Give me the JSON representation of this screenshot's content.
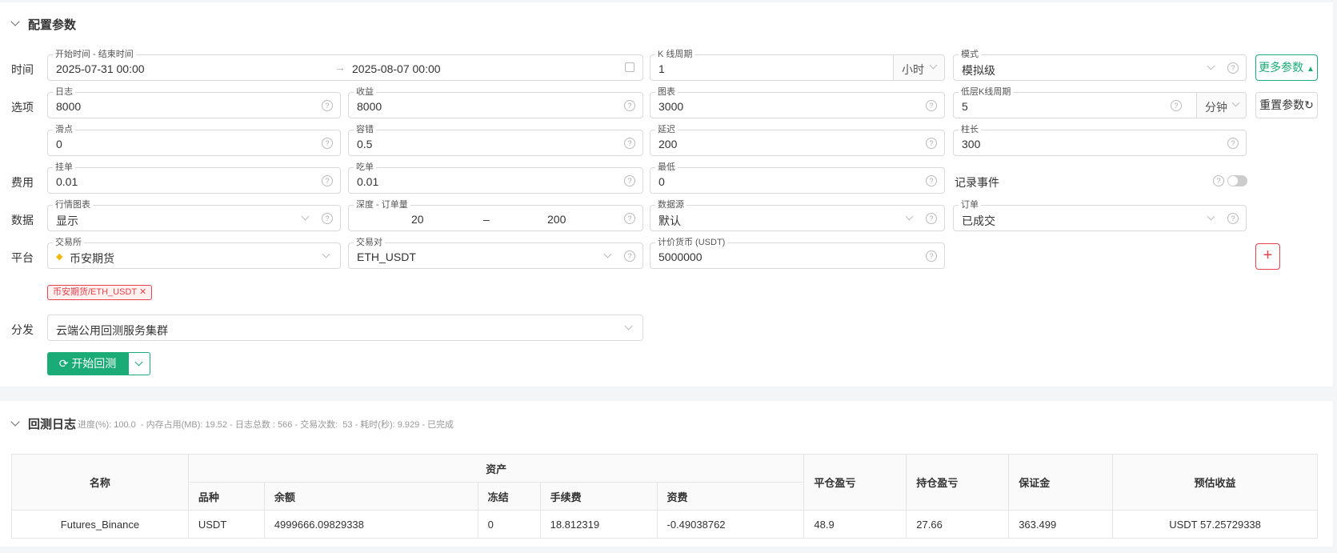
{
  "config": {
    "title": "配置参数",
    "row_labels": {
      "time": "时间",
      "options": "选项",
      "fees": "费用",
      "data": "数据",
      "platform": "平台",
      "dispatch": "分发"
    },
    "time_range": {
      "label": "开始时间 - 结束时间",
      "start": "2025-07-31 00:00",
      "end": "2025-08-07 00:00"
    },
    "kline_period": {
      "label": "K 线周期",
      "value": "1",
      "unit": "小时"
    },
    "mode": {
      "label": "模式",
      "value": "模拟级"
    },
    "more_params": "更多参数",
    "reset_params": "重置参数",
    "log": {
      "label": "日志",
      "value": "8000"
    },
    "profit": {
      "label": "收益",
      "value": "8000"
    },
    "chart": {
      "label": "图表",
      "value": "3000"
    },
    "low_kline": {
      "label": "低层K线周期",
      "value": "5",
      "unit": "分钟"
    },
    "slippage": {
      "label": "滑点",
      "value": "0"
    },
    "tolerance": {
      "label": "容错",
      "value": "0.5"
    },
    "delay": {
      "label": "延迟",
      "value": "200"
    },
    "bar_length": {
      "label": "柱长",
      "value": "300"
    },
    "maker": {
      "label": "挂单",
      "value": "0.01"
    },
    "taker": {
      "label": "吃单",
      "value": "0.01"
    },
    "minimum": {
      "label": "最低",
      "value": "0"
    },
    "record_events": {
      "label": "记录事件",
      "enabled": false
    },
    "market_chart": {
      "label": "行情图表",
      "value": "显示"
    },
    "depth": {
      "label": "深度 - 订单量",
      "from": "20",
      "sep": "–",
      "to": "200"
    },
    "datasource": {
      "label": "数据源",
      "value": "默认"
    },
    "orders": {
      "label": "订单",
      "value": "已成交"
    },
    "exchange": {
      "label": "交易所",
      "value": "币安期货"
    },
    "pair": {
      "label": "交易对",
      "value": "ETH_USDT"
    },
    "quote": {
      "label": "计价货币 (USDT)",
      "value": "5000000"
    },
    "tag": "币安期货/ETH_USDT",
    "dispatch": "云端公用回测服务集群",
    "start_button": "开始回测"
  },
  "backtest_log": {
    "title": "回测日志",
    "summary": "进度(%): 100.0  - 内存占用(MB): 19.52 - 日志总数 : 566 - 交易次数:  53 - 耗时(秒): 9.929 - 已完成",
    "headers": {
      "name": "名称",
      "assets": "资产",
      "symbol": "品种",
      "balance": "余额",
      "frozen": "冻结",
      "fee": "手续费",
      "funding": "资费",
      "close_pnl": "平仓盈亏",
      "hold_pnl": "持仓盈亏",
      "margin": "保证金",
      "est_profit": "预估收益"
    },
    "row": {
      "name": "Futures_Binance",
      "symbol": "USDT",
      "balance": "4999666.09829338",
      "frozen": "0",
      "fee": "18.812319",
      "funding": "-0.49038762",
      "close_pnl": "48.9",
      "hold_pnl": "27.66",
      "margin": "363.499",
      "est_profit": "USDT 57.25729338"
    }
  },
  "colors": {
    "accent": "#1aab76",
    "danger": "#e8414d"
  }
}
